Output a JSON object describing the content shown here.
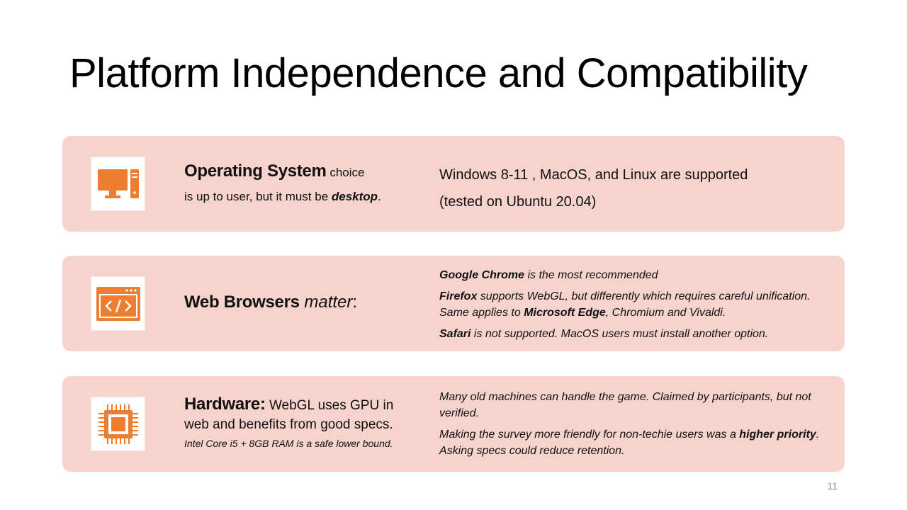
{
  "slide": {
    "title": "Platform Independence and Compatibility",
    "page_number": "11",
    "accent_color": "#ed7d31",
    "card_color": "#f6d3cc"
  },
  "cards": [
    {
      "icon": "desktop-computer-icon",
      "heading": "Operating System",
      "heading_suffix": " choice",
      "line2_prefix": "is up to user, but it must be ",
      "line2_emphasis": "desktop",
      "line2_suffix": ".",
      "details": [
        "Windows 8-11 , MacOS, and Linux are supported",
        "(tested on Ubuntu 20.04)"
      ]
    },
    {
      "icon": "browser-code-icon",
      "heading": "Web Browsers",
      "heading_emphasis": "matter",
      "heading_suffix": ":",
      "details": [
        {
          "bold": "Google Chrome",
          "text": " is the most recommended"
        },
        {
          "bold": "Firefox",
          "text": " supports WebGL, but differently which requires careful unification.  Same applies to ",
          "bold2": "Microsoft Edge",
          "text2": ", Chromium and Vivaldi."
        },
        {
          "bold": "Safari",
          "text": " is not supported. MacOS users must install another option."
        }
      ]
    },
    {
      "icon": "processor-chip-icon",
      "heading": "Hardware",
      "heading_colon": ":",
      "heading_suffix": " WebGL uses GPU in",
      "line2": "web and benefits from good specs.",
      "line3": "Intel Core i5 + 8GB RAM is a safe lower bound.",
      "details": [
        {
          "text": "Many old machines can handle the game. Claimed by participants, but not verified."
        },
        {
          "text": "Making the survey more friendly for non-techie users was a ",
          "bold": "higher priority",
          "text2": ". Asking specs could reduce retention."
        }
      ]
    }
  ]
}
